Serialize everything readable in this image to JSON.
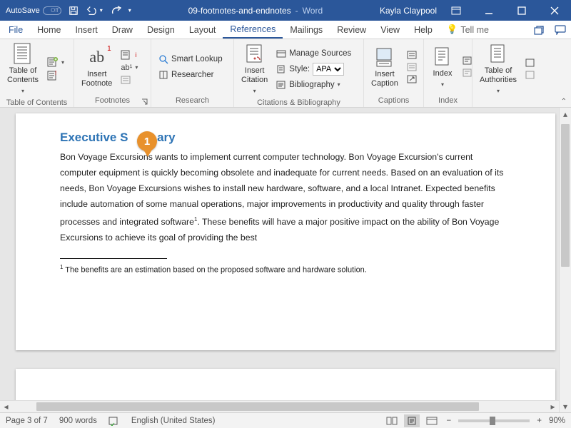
{
  "title_bar": {
    "autosave_label": "AutoSave",
    "autosave_state": "Off",
    "doc_name": "09-footnotes-and-endnotes",
    "app_suffix": "Word",
    "user": "Kayla Claypool"
  },
  "menu": {
    "items": [
      "File",
      "Home",
      "Insert",
      "Draw",
      "Design",
      "Layout",
      "References",
      "Mailings",
      "Review",
      "View",
      "Help"
    ],
    "active": "References",
    "tellme_placeholder": "Tell me"
  },
  "ribbon": {
    "toc": {
      "label": "Table of Contents",
      "big": "Table of\nContents"
    },
    "footnotes": {
      "label": "Footnotes",
      "big": "Insert\nFootnote",
      "ab_text": "ab"
    },
    "research": {
      "label": "Research",
      "smart": "Smart Lookup",
      "researcher": "Researcher"
    },
    "citations": {
      "label": "Citations & Bibliography",
      "big": "Insert\nCitation",
      "manage": "Manage Sources",
      "style_label": "Style:",
      "style_value": "APA",
      "bibliography": "Bibliography"
    },
    "captions": {
      "label": "Captions",
      "big": "Insert\nCaption"
    },
    "index": {
      "label": "Index",
      "big": "Index"
    },
    "authorities": {
      "label": "",
      "big": "Table of\nAuthorities"
    }
  },
  "document": {
    "heading": "Executive Summary",
    "heading_display_prefix": "Executive S",
    "heading_display_suffix": "ary",
    "body": "Bon Voyage Excursions wants to implement current computer technology. Bon Voyage Excursion's current computer equipment is quickly becoming obsolete and inadequate for current needs. Based on an evaluation of its needs, Bon Voyage Excursions wishes to install new hardware, software, and a local Intranet. Expected benefits include automation of some manual operations, major improvements in productivity and quality through faster processes and integrated software",
    "body_tail": ". These benefits will have a major positive impact on the ability of Bon Voyage Excursions to achieve its goal of providing the best",
    "footnote_marker": "1",
    "footnote_text": " The benefits are an estimation based on the proposed software and hardware solution."
  },
  "callout": {
    "number": "1"
  },
  "status": {
    "page": "Page 3 of 7",
    "words": "900 words",
    "language": "English (United States)",
    "zoom": "90%"
  }
}
